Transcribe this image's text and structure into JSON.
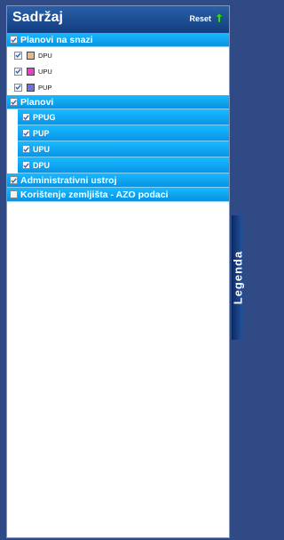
{
  "header": {
    "title": "Sadržaj",
    "reset_label": "Reset"
  },
  "groups": [
    {
      "label": "Planovi na snazi",
      "checked": true
    },
    {
      "label": "Planovi",
      "checked": true
    },
    {
      "label": "Administrativni ustroj",
      "checked": true
    },
    {
      "label": "Korištenje zemljišta - AZO podaci",
      "checked": false
    }
  ],
  "planovi_na_snazi_items": [
    {
      "label": "DPU",
      "color": "#e7b98a",
      "checked": true
    },
    {
      "label": "UPU",
      "color": "#ef3cd0",
      "checked": true
    },
    {
      "label": "PUP",
      "color": "#6e6ff1",
      "checked": true
    }
  ],
  "planovi_items": [
    {
      "label": "PPUG",
      "checked": true
    },
    {
      "label": "PUP",
      "checked": true
    },
    {
      "label": "UPU",
      "checked": true
    },
    {
      "label": "DPU",
      "checked": true
    }
  ],
  "legend_tab": {
    "label": "Legenda"
  },
  "colors": {
    "accent": "#0693e3",
    "header": "#1a4b92",
    "background": "#2f4a85"
  }
}
